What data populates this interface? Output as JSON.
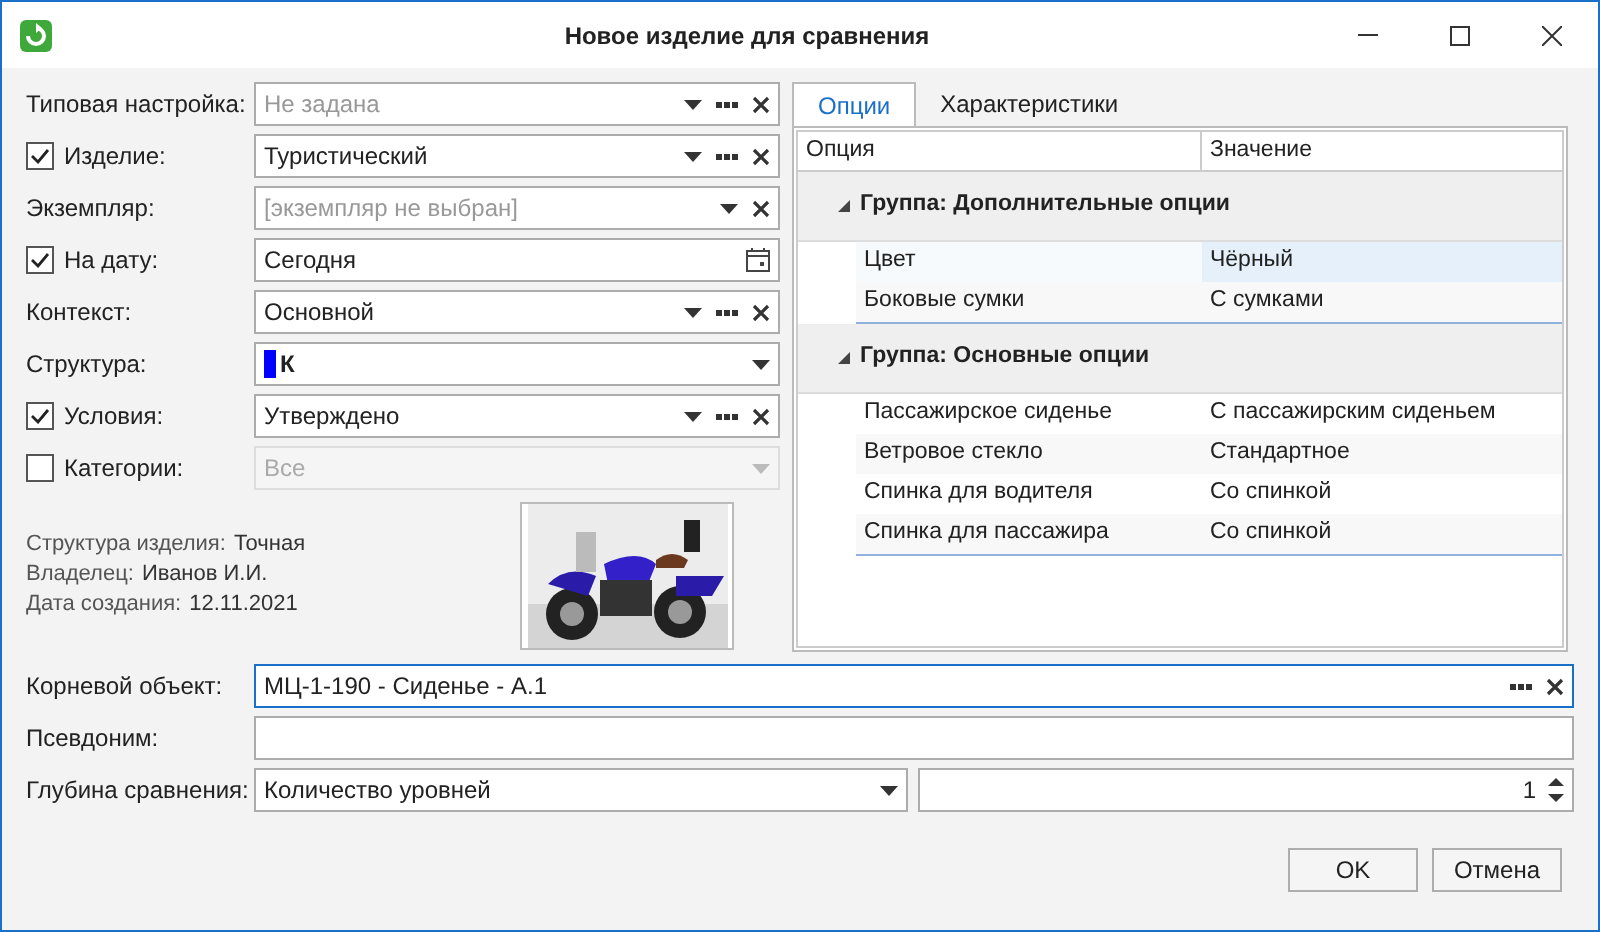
{
  "window": {
    "title": "Новое изделие для сравнения"
  },
  "fields": [
    {
      "label": "Типовая настройка:",
      "placeholder": "Не задана",
      "disabled": false,
      "dropdown": true,
      "more": true,
      "clear": true
    },
    {
      "label": "Изделие:",
      "checked": true,
      "value": "Туристический",
      "disabled": false,
      "dropdown": true,
      "more": true,
      "clear": true
    },
    {
      "label": "Экземпляр:",
      "placeholder": "[экземпляр не выбран]",
      "disabled": false,
      "dropdown": true,
      "clear": true
    },
    {
      "label": "На дату:",
      "checked": true,
      "value": "Сегодня",
      "disabled": false,
      "calendar": true
    },
    {
      "label": "Контекст:",
      "value": "Основной",
      "disabled": false,
      "dropdown": true,
      "more": true,
      "clear": true
    },
    {
      "label": "Структура:",
      "value": "К",
      "color": "#0000ff",
      "bold": true,
      "disabled": false,
      "dropdown": true
    },
    {
      "label": "Условия:",
      "checked": true,
      "value": "Утверждено",
      "disabled": false,
      "dropdown": true,
      "more": true,
      "clear": true
    },
    {
      "label": "Категории:",
      "checked": false,
      "value": "Все",
      "disabled": true,
      "dropdown": true
    }
  ],
  "info": [
    {
      "label": "Структура изделия:",
      "value": "Точная"
    },
    {
      "label": "Владелец:",
      "value": "Иванов И.И."
    },
    {
      "label": "Дата создания:",
      "value": "12.11.2021"
    }
  ],
  "preview": {
    "kind": "picture"
  },
  "tabs": [
    {
      "label": "Опции",
      "selected": true
    },
    {
      "label": "Характеристики",
      "selected": false
    }
  ],
  "grid": {
    "columns": [
      "Опция",
      "Значение"
    ],
    "groups": [
      {
        "title": "Группа: Дополнительные опции",
        "expanded": true,
        "rows": [
          {
            "option": "Цвет",
            "value": "Чёрный",
            "selected": true
          },
          {
            "option": "Боковые сумки",
            "value": "С сумками",
            "selected": false
          }
        ]
      },
      {
        "title": "Группа: Основные опции",
        "expanded": true,
        "rows": [
          {
            "option": "Пассажирское сиденье",
            "value": "С пассажирским сиденьем",
            "selected": false
          },
          {
            "option": "Ветровое стекло",
            "value": "Стандартное",
            "selected": false
          },
          {
            "option": "Спинка для водителя",
            "value": "Со спинкой",
            "selected": false
          },
          {
            "option": "Спинка для пассажира",
            "value": "Со спинкой",
            "selected": false
          }
        ]
      }
    ]
  },
  "root_object": {
    "label": "Корневой объект:",
    "value": "МЦ-1-190 - Сиденье - А.1",
    "focused": true
  },
  "alias": {
    "label": "Псевдоним:"
  },
  "depth": {
    "label": "Глубина сравнения:",
    "mode": "Количество уровней",
    "count": "1"
  },
  "buttons": [
    "OK",
    "Отмена"
  ]
}
